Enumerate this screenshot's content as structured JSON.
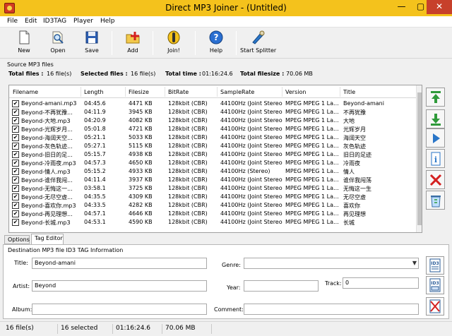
{
  "window": {
    "title": "Direct MP3 Joiner - (Untitled)",
    "minimize": "—",
    "maximize": "▢",
    "close": "✕"
  },
  "menu": [
    "File",
    "Edit",
    "ID3TAG",
    "Player",
    "Help"
  ],
  "toolbar": {
    "new": "New",
    "open": "Open",
    "save": "Save",
    "add": "Add",
    "join": "Join!",
    "help": "Help",
    "splitter": "Start Splitter"
  },
  "source": {
    "group_label": "Source MP3 files",
    "total_files_label": "Total files :",
    "total_files": "16 file(s)",
    "selected_files_label": "Selected files :",
    "selected_files": "16 file(s)",
    "total_time_label": "Total time :",
    "total_time": "01:16:24.6",
    "total_filesize_label": "Total filesize :",
    "total_filesize": "70.06 MB"
  },
  "table": {
    "columns": [
      "Filename",
      "Length",
      "Filesize",
      "BitRate",
      "SampleRate",
      "Version",
      "Title"
    ],
    "rows": [
      [
        "Beyond-amani.mp3",
        "04:45.6",
        "4471 KB",
        "128kbit (CBR)",
        "44100Hz (Joint Stereo)",
        "MPEG MPEG 1 La...",
        "Beyond-amani"
      ],
      [
        "Beyond-不再犹豫...",
        "04:11.9",
        "3945 KB",
        "128kbit (CBR)",
        "44100Hz (Joint Stereo)",
        "MPEG MPEG 1 La...",
        "不再犹豫"
      ],
      [
        "Beyond-大地.mp3",
        "04:20.9",
        "4082 KB",
        "128kbit (CBR)",
        "44100Hz (Joint Stereo)",
        "MPEG MPEG 1 La...",
        "大地"
      ],
      [
        "Beyond-光辉岁月...",
        "05:01.8",
        "4721 KB",
        "128kbit (CBR)",
        "44100Hz (Joint Stereo)",
        "MPEG MPEG 1 La...",
        "光辉岁月"
      ],
      [
        "Beyond-海阔天空...",
        "05:21.1",
        "5033 KB",
        "128kbit (CBR)",
        "44100Hz (Joint Stereo)",
        "MPEG MPEG 1 La...",
        "海阔天空"
      ],
      [
        "Beyond-灰色轨迹...",
        "05:27.1",
        "5115 KB",
        "128kbit (CBR)",
        "44100Hz (Joint Stereo)",
        "MPEG MPEG 1 La...",
        "灰色轨迹"
      ],
      [
        "Beyond-旧日的足...",
        "05:15.7",
        "4938 KB",
        "128kbit (CBR)",
        "44100Hz (Joint Stereo)",
        "MPEG MPEG 1 La...",
        "旧日的足迹"
      ],
      [
        "Beyond-冷雨夜.mp3",
        "04:57.3",
        "4650 KB",
        "128kbit (CBR)",
        "44100Hz (Joint Stereo)",
        "MPEG MPEG 1 La...",
        "冷雨夜"
      ],
      [
        "Beyond-情人.mp3",
        "05:15.2",
        "4933 KB",
        "128kbit (CBR)",
        "44100Hz (Stereo)",
        "MPEG MPEG 1 La...",
        "情人"
      ],
      [
        "Beyond-谁伴我闯...",
        "04:11.4",
        "3937 KB",
        "128kbit (CBR)",
        "44100Hz (Joint Stereo)",
        "MPEG MPEG 1 La...",
        "谁伴我闯荡"
      ],
      [
        "Beyond-无悔这一...",
        "03:58.1",
        "3725 KB",
        "128kbit (CBR)",
        "44100Hz (Joint Stereo)",
        "MPEG MPEG 1 La...",
        "无悔这一生"
      ],
      [
        "Beyond-无尽空虚...",
        "04:35.5",
        "4309 KB",
        "128kbit (CBR)",
        "44100Hz (Joint Stereo)",
        "MPEG MPEG 1 La...",
        "无尽空虚"
      ],
      [
        "Beyond-喜欢你.mp3",
        "04:33.5",
        "4282 KB",
        "128kbit (CBR)",
        "44100Hz (Joint Stereo)",
        "MPEG MPEG 1 La...",
        "喜欢你"
      ],
      [
        "Beyond-再见理想...",
        "04:57.1",
        "4646 KB",
        "128kbit (CBR)",
        "44100Hz (Joint Stereo)",
        "MPEG MPEG 1 La...",
        "再见理想"
      ],
      [
        "Beyond-长城.mp3",
        "04:53.1",
        "4590 KB",
        "128kbit (CBR)",
        "44100Hz (Joint Stereo)",
        "MPEG MPEG 1 La...",
        "长城"
      ]
    ]
  },
  "tabs": {
    "options": "Options",
    "tag_editor": "Tag Editor"
  },
  "tag_editor": {
    "group_label": "Destination MP3 file ID3 TAG Information",
    "title_label": "Title:",
    "title_value": "Beyond-amani",
    "artist_label": "Artist:",
    "artist_value": "Beyond",
    "album_label": "Album:",
    "album_value": "",
    "genre_label": "Genre:",
    "genre_value": "",
    "year_label": "Year:",
    "year_value": "",
    "track_label": "Track:",
    "track_value": "0",
    "comment_label": "Comment:",
    "comment_value": ""
  },
  "status": {
    "files": "16 file(s)",
    "selected": "16 selected",
    "time": "01:16:24.6",
    "size": "70.06 MB"
  },
  "colors": {
    "titlebar": "#f4c21c",
    "close_button": "#c7402b",
    "delete_red": "#d42020",
    "move_green": "#2f9a3a",
    "play_blue": "#2a76c8"
  }
}
